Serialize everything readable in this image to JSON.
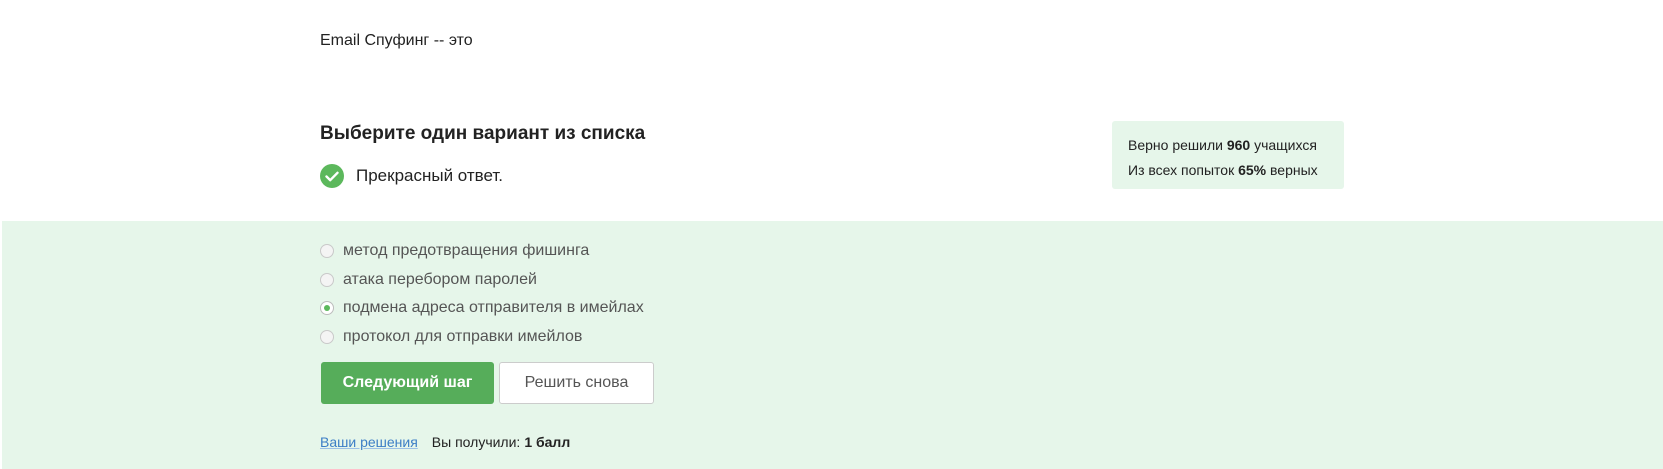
{
  "question": {
    "text": "Email Спуфинг -- это"
  },
  "task": {
    "heading": "Выберите один вариант из списка",
    "feedback": "Прекрасный ответ."
  },
  "stats": {
    "solved_prefix": "Верно решили",
    "solved_count": "960",
    "solved_suffix": "учащихся",
    "attempts_prefix": "Из всех попыток",
    "attempts_percent": "65%",
    "attempts_suffix": "верных"
  },
  "options": [
    {
      "label": "метод предотвращения фишинга",
      "checked": false
    },
    {
      "label": "атака перебором паролей",
      "checked": false
    },
    {
      "label": "подмена адреса отправителя в имейлах",
      "checked": true
    },
    {
      "label": "протокол для отправки имейлов",
      "checked": false
    }
  ],
  "buttons": {
    "next_label": "Следующий шаг",
    "retry_label": "Решить снова"
  },
  "footer": {
    "solutions_link": "Ваши решения",
    "score_label": "Вы получили:",
    "score_value": "1 балл"
  },
  "colors": {
    "accent_green": "#56ad5a",
    "answer_background": "#e6f6ea",
    "link_blue": "#3c7ec6"
  },
  "icons": {
    "feedback_icon": "check-circle-icon"
  }
}
